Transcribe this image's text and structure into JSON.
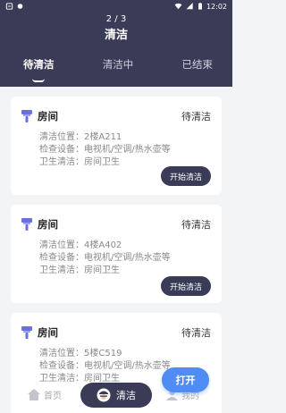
{
  "status_bar": {
    "time": "12:02"
  },
  "header": {
    "page_indicator": "2 / 3",
    "title": "清洁",
    "tabs": [
      {
        "label": "待清洁",
        "active": true
      },
      {
        "label": "清洁中",
        "active": false
      },
      {
        "label": "已结束",
        "active": false
      }
    ]
  },
  "cards": [
    {
      "title": "房间",
      "status": "待清洁",
      "location": "清洁位置：2楼A211",
      "equipment": "检查设备：电视机/空调/热水壶等",
      "hygiene": "卫生清洁：房间卫生",
      "button": "开始清洁"
    },
    {
      "title": "房间",
      "status": "待清洁",
      "location": "清洁位置：4楼A402",
      "equipment": "检查设备：电视机/空调/热水壶等",
      "hygiene": "卫生清洁：房间卫生",
      "button": "开始清洁"
    },
    {
      "title": "房间",
      "status": "待清洁",
      "location": "清洁位置：5楼C519",
      "equipment": "检查设备：电视机/空调/热水壶等",
      "hygiene": "卫生清洁：房间卫生"
    }
  ],
  "bottom_nav": {
    "home": "首页",
    "clean": "清洁",
    "mine": "我的"
  },
  "fab": {
    "label": "打开",
    "color": "#4f8df5"
  },
  "colors": {
    "primary": "#3a3c57",
    "accent": "#6b6fe0"
  }
}
